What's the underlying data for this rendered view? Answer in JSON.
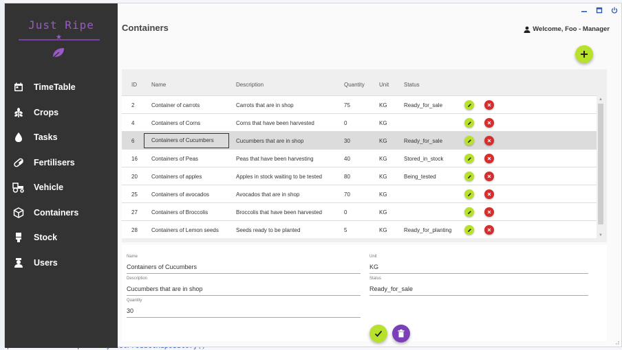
{
  "app": {
    "name": "Just Ripe"
  },
  "window": {
    "controls": [
      "minimize-icon",
      "maximize-icon",
      "power-icon"
    ]
  },
  "sidebar": {
    "items": [
      {
        "label": "TimeTable",
        "icon": "calendar-icon"
      },
      {
        "label": "Crops",
        "icon": "crop-icon"
      },
      {
        "label": "Tasks",
        "icon": "drop-icon"
      },
      {
        "label": "Fertilisers",
        "icon": "pill-icon"
      },
      {
        "label": "Vehicle",
        "icon": "tractor-icon"
      },
      {
        "label": "Containers",
        "icon": "box-icon"
      },
      {
        "label": "Stock",
        "icon": "stock-icon"
      },
      {
        "label": "Users",
        "icon": "user-icon"
      }
    ]
  },
  "header": {
    "title": "Containers",
    "welcome": "Welcome, Foo - Manager"
  },
  "table": {
    "columns": [
      "ID",
      "Name",
      "Description",
      "Quantity",
      "Unit",
      "Status"
    ],
    "rows": [
      {
        "id": "2",
        "name": "Container of carrots",
        "description": "Carrots that are in shop",
        "quantity": "75",
        "unit": "KG",
        "status": "Ready_for_sale"
      },
      {
        "id": "4",
        "name": "Containers of Corns",
        "description": "Corns that have been harvested",
        "quantity": "0",
        "unit": "KG",
        "status": ""
      },
      {
        "id": "6",
        "name": "Containers of Cucumbers",
        "description": "Cucumbers that are in shop",
        "quantity": "30",
        "unit": "KG",
        "status": "Ready_for_sale"
      },
      {
        "id": "16",
        "name": "Containers of Peas",
        "description": "Peas that have been harvesting",
        "quantity": "40",
        "unit": "KG",
        "status": "Stored_in_stock"
      },
      {
        "id": "20",
        "name": "Containers of apples",
        "description": "Apples in stock waiting to be tested",
        "quantity": "80",
        "unit": "KG",
        "status": "Being_tested"
      },
      {
        "id": "25",
        "name": "Containers of avocados",
        "description": "Avocados that are in shop",
        "quantity": "70",
        "unit": "KG",
        "status": ""
      },
      {
        "id": "27",
        "name": "Containers of Broccolis",
        "description": "Broccolis that have been harvested",
        "quantity": "0",
        "unit": "KG",
        "status": ""
      },
      {
        "id": "28",
        "name": "Containers of Lemon seeds",
        "description": "Seeds ready to be planted",
        "quantity": "5",
        "unit": "KG",
        "status": "Ready_for_planting"
      }
    ],
    "selected_index": 2
  },
  "form": {
    "name_label": "Name",
    "name_value": "Containers of Cucumbers",
    "unit_label": "Unit",
    "unit_value": "KG",
    "description_label": "Description",
    "description_value": "Cucumbers that are in shop",
    "status_label": "Status",
    "status_value": "Ready_for_sale",
    "quantity_label": "Quantity",
    "quantity_value": "30"
  },
  "background": {
    "code_line": "private ProductRepository GetProductRepository()"
  },
  "colors": {
    "sidebar": "#333333",
    "accent_green": "#b7e12b",
    "accent_purple": "#7b3fb8",
    "delete_red": "#d32f2f",
    "logo_purple": "#9b59c7"
  }
}
